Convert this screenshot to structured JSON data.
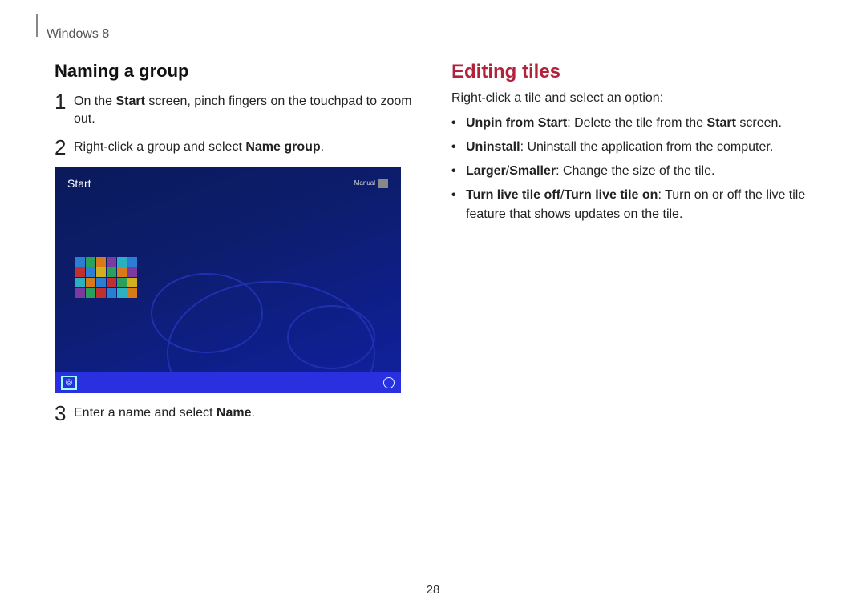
{
  "breadcrumb": "Windows 8",
  "page_number": "28",
  "left": {
    "heading": "Naming a group",
    "steps": [
      {
        "num": "1",
        "html": "On the <b>Start</b> screen, pinch fingers on the touchpad to zoom out."
      },
      {
        "num": "2",
        "html": "Right-click a group and select <b>Name group</b>."
      },
      {
        "num": "3",
        "html": "Enter a name and select <b>Name</b>."
      }
    ],
    "screenshot": {
      "title": "Start",
      "user": "Manual"
    }
  },
  "right": {
    "heading": "Editing tiles",
    "intro": "Right-click a tile and select an option:",
    "bullets": [
      "<b>Unpin from Start</b>: Delete the tile from the <b>Start</b> screen.",
      "<b>Uninstall</b>: Uninstall the application from the computer.",
      "<b>Larger</b>/<b>Smaller</b>: Change the size of the tile.",
      "<b>Turn live tile off</b>/<b>Turn live tile on</b>: Turn on or off the live tile feature that shows updates on the tile."
    ]
  }
}
